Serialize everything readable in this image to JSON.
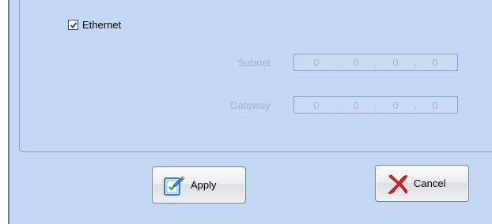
{
  "ethernet": {
    "label": "Ethernet",
    "checked": true
  },
  "subnet": {
    "label": "Subnet",
    "octets": [
      "0",
      "0",
      "0",
      "0"
    ]
  },
  "gateway": {
    "label": "Gateway",
    "octets": [
      "0",
      "0",
      "0",
      "0"
    ]
  },
  "buttons": {
    "apply": "Apply",
    "cancel": "Cancel"
  },
  "icons": {
    "apply": "apply-edit-icon",
    "cancel": "cancel-x-icon"
  }
}
